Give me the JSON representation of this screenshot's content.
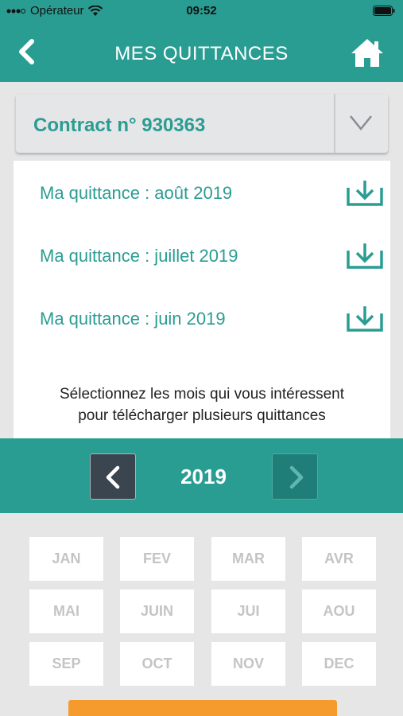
{
  "status_bar": {
    "carrier": "Opérateur",
    "time": "09:52"
  },
  "nav": {
    "title": "MES QUITTANCES",
    "back_icon": "chevron-left-icon",
    "home_icon": "home-icon"
  },
  "contract": {
    "label": "Contract n° 930363"
  },
  "receipts": [
    {
      "label": "Ma quittance : août 2019"
    },
    {
      "label": "Ma quittance : juillet 2019"
    },
    {
      "label": "Ma quittance : juin 2019"
    }
  ],
  "instruction": {
    "line1": "Sélectionnez les mois qui vous intéressent",
    "line2": "pour télécharger plusieurs quittances"
  },
  "year_selector": {
    "year": "2019"
  },
  "months": [
    "JAN",
    "FEV",
    "MAR",
    "AVR",
    "MAI",
    "JUIN",
    "JUI",
    "AOU",
    "SEP",
    "OCT",
    "NOV",
    "DEC"
  ],
  "colors": {
    "accent": "#2a9d93",
    "orange": "#f59a2c",
    "dark_button": "#3a4550"
  }
}
